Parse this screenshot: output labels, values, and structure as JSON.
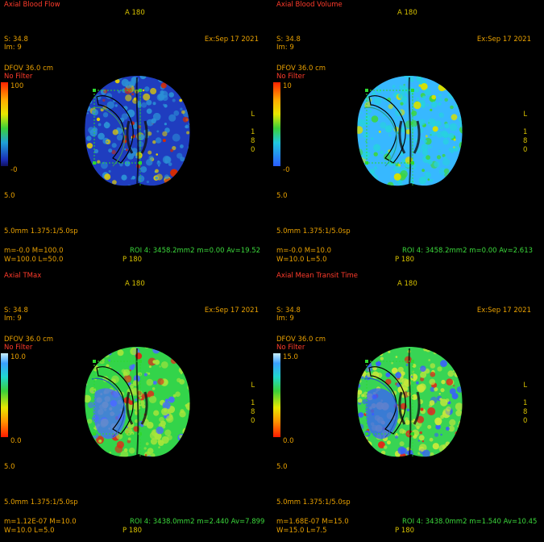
{
  "viewports": [
    {
      "title": "Axial Blood Flow",
      "anterior": "A 180",
      "slice_pos": "S: 34.8",
      "image_num": "Im: 9",
      "date": "Ex:Sep 17 2021",
      "dfov": "DFOV 36.0 cm",
      "filter": "No Filter",
      "scale_max": "100",
      "scale_min": "-0",
      "five": "5.0",
      "slice": "5.0mm 1.375:1/5.0sp",
      "minmax": "m=-0.0 M=100.0",
      "window": "W=100.0 L=50.0",
      "roi": "ROI 4: 3458.2mm2 m=0.00   Av=19.52",
      "posterior": "P 180",
      "orient_letters": [
        "L",
        "1",
        "8",
        "0"
      ],
      "roi_index": "4",
      "colormap": "bf",
      "colors": {
        "bg": "#1f3dbf",
        "mid": "#2b8fd6",
        "hot1": "#e6d000",
        "hot2": "#d82a00",
        "ring": "#3b8f6a"
      }
    },
    {
      "title": "Axial Blood Volume",
      "anterior": "A 180",
      "slice_pos": "S: 34.8",
      "image_num": "Im: 9",
      "date": "Ex:Sep 17 2021",
      "dfov": "DFOV 36.0 cm",
      "filter": "No Filter",
      "scale_max": "10",
      "scale_min": "-0",
      "five": "5.0",
      "slice": "5.0mm 1.375:1/5.0sp",
      "minmax": "m=-0.0 M=10.0",
      "window": "W=10.0 L=5.0",
      "roi": "ROI 4: 3458.2mm2 m=0.00   Av=2.613",
      "posterior": "P 180",
      "orient_letters": [
        "L",
        "1",
        "8",
        "0"
      ],
      "roi_index": "4",
      "colormap": "bv",
      "colors": {
        "bg": "#37b8ff",
        "mid": "#27d1e0",
        "hot1": "#3ed63e",
        "hot2": "#d8e000",
        "ring": "#2a9d8f"
      }
    },
    {
      "title": "Axial TMax",
      "anterior": "A 180",
      "slice_pos": "S: 34.8",
      "image_num": "Im: 9",
      "date": "Ex:Sep 17 2021",
      "dfov": "DFOV 36.0 cm",
      "filter": "No Filter",
      "scale_max": "10.0",
      "scale_min": "0.0",
      "five": "5.0",
      "slice": "5.0mm 1.375:1/5.0sp",
      "minmax": "m=1.12E-07 M=10.0",
      "window": "W=10.0 L=5.0",
      "roi": "ROI 4: 3438.0mm2 m=2.440   Av=7.899",
      "posterior": "P 180",
      "orient_letters": [
        "L",
        "1",
        "8",
        "0"
      ],
      "roi_index": "4",
      "colormap": "tmax",
      "colors": {
        "bg": "#33d44a",
        "mid": "#a8e53a",
        "hot1": "#4a6bff",
        "hot2": "#e02a1a",
        "ring": "#1f5fbf"
      }
    },
    {
      "title": "Axial Mean Transit Time",
      "anterior": "A 180",
      "slice_pos": "S: 34.8",
      "image_num": "Im: 9",
      "date": "Ex:Sep 17 2021",
      "dfov": "DFOV 36.0 cm",
      "filter": "No Filter",
      "scale_max": "15.0",
      "scale_min": "0.0",
      "five": "5.0",
      "slice": "5.0mm 1.375:1/5.0sp",
      "minmax": "m=1.68E-07 M=15.0",
      "window": "W=15.0 L=7.5",
      "roi": "ROI 4: 3438.0mm2 m=1.540   Av=10.45",
      "posterior": "P 180",
      "orient_letters": [
        "L",
        "1",
        "8",
        "0"
      ],
      "roi_index": "4",
      "colormap": "mtt",
      "colors": {
        "bg": "#38d454",
        "mid": "#c9e83a",
        "hot1": "#3a5dff",
        "hot2": "#e02a1a",
        "ring": "#1f5fbf"
      }
    }
  ]
}
